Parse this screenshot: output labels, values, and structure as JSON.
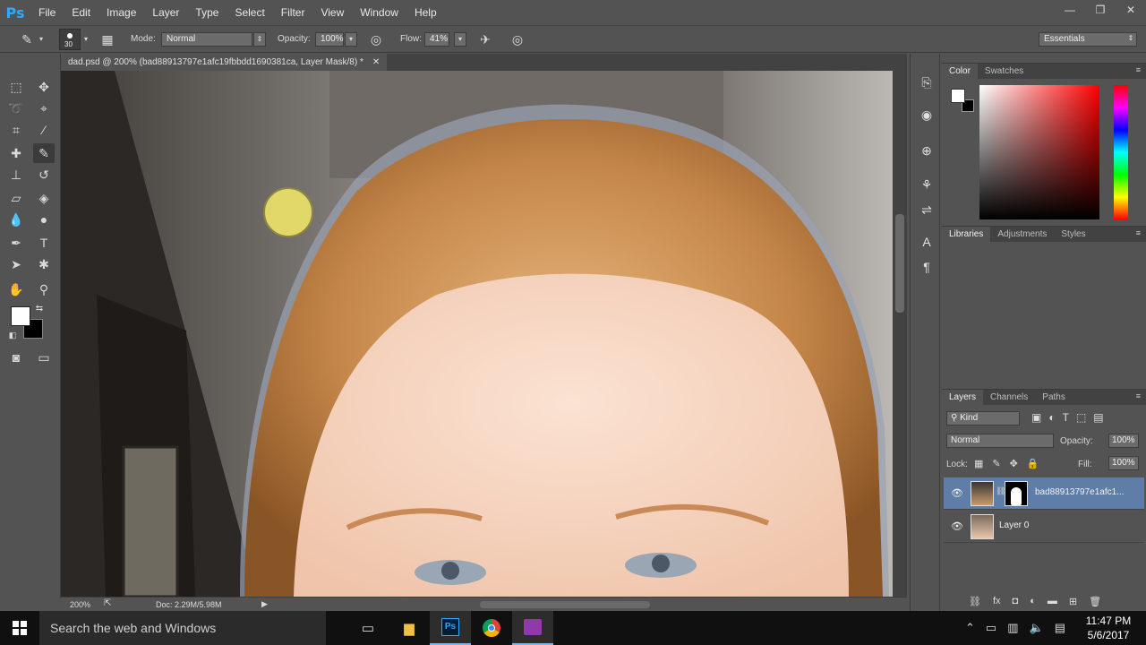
{
  "menubar": {
    "logo": "Ps",
    "items": [
      "File",
      "Edit",
      "Image",
      "Layer",
      "Type",
      "Select",
      "Filter",
      "View",
      "Window",
      "Help"
    ],
    "window_controls": [
      "—",
      "❐",
      "✕"
    ]
  },
  "options": {
    "brush_size": "30",
    "mode_label": "Mode:",
    "mode_value": "Normal",
    "opacity_label": "Opacity:",
    "opacity_value": "100%",
    "flow_label": "Flow:",
    "flow_value": "41%",
    "workspace": "Essentials"
  },
  "document": {
    "tab_title": "dad.psd @ 200% (bad88913797e1afc19fbbdd1690381ca, Layer Mask/8) *",
    "tab_close": "✕",
    "zoom": "200%",
    "doc_size": "Doc: 2.29M/5.98M"
  },
  "colors": {
    "foreground": "#ffffff",
    "background": "#000000",
    "picker_hue": "#ff0000",
    "selection": "#5e7ea8"
  },
  "color_panel": {
    "tabs": [
      "Color",
      "Swatches"
    ]
  },
  "libraries_panel": {
    "tabs": [
      "Libraries",
      "Adjustments",
      "Styles"
    ]
  },
  "layers_panel": {
    "tabs": [
      "Layers",
      "Channels",
      "Paths"
    ],
    "filter_kind": "Kind",
    "blend_mode": "Normal",
    "opacity_label": "Opacity:",
    "opacity_value": "100%",
    "lock_label": "Lock:",
    "fill_label": "Fill:",
    "fill_value": "100%",
    "layers": [
      {
        "name": "bad88913797e1afc1...",
        "visible": true,
        "selected": true
      },
      {
        "name": "Layer 0",
        "visible": true,
        "selected": false
      }
    ],
    "footer_icons": [
      "link-icon",
      "fx-icon",
      "mask-icon",
      "adjustment-icon",
      "folder-icon",
      "new-layer-icon",
      "trash-icon"
    ]
  },
  "taskbar": {
    "search_placeholder": "Search the web and Windows",
    "time": "11:47 PM",
    "date": "5/6/2017"
  }
}
